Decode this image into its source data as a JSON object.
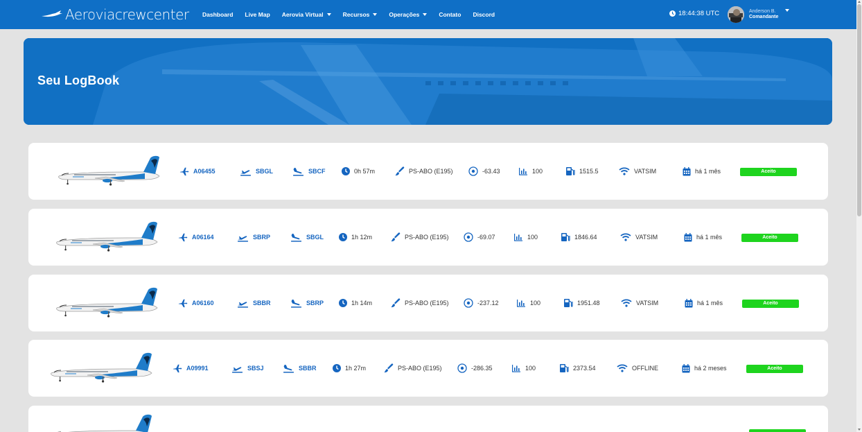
{
  "brand": {
    "name_part1": "Aerovia",
    "name_part2": "crewcenter"
  },
  "nav": {
    "items": [
      {
        "label": "Dashboard",
        "dropdown": false
      },
      {
        "label": "Live Map",
        "dropdown": false
      },
      {
        "label": "Aerovia Virtual",
        "dropdown": true
      },
      {
        "label": "Recursos",
        "dropdown": true
      },
      {
        "label": "Operações",
        "dropdown": true
      },
      {
        "label": "Contato",
        "dropdown": false
      },
      {
        "label": "Discord",
        "dropdown": false
      }
    ]
  },
  "clock": {
    "time": "18:44:38 UTC"
  },
  "user": {
    "name": "Anderson B.",
    "rank": "Comandante"
  },
  "hero": {
    "title": "Seu LogBook"
  },
  "colors": {
    "primary": "#0f6fc6",
    "accent_text": "#1565c0",
    "accepted": "#1ed41e",
    "page_bg": "#e3e3e3"
  },
  "logbook": [
    {
      "flight": "A06455",
      "departure": "SBGL",
      "arrival": "SBCF",
      "duration": "0h 57m",
      "aircraft": "PS-ABO (E195)",
      "landing_rate": "-63.43",
      "score": "100",
      "fuel": "1515.5",
      "network": "VATSIM",
      "date": "há 1 mês",
      "status": "Aceito"
    },
    {
      "flight": "A06164",
      "departure": "SBRP",
      "arrival": "SBGL",
      "duration": "1h 12m",
      "aircraft": "PS-ABO (E195)",
      "landing_rate": "-69.07",
      "score": "100",
      "fuel": "1846.64",
      "network": "VATSIM",
      "date": "há 1 mês",
      "status": "Aceito"
    },
    {
      "flight": "A06160",
      "departure": "SBBR",
      "arrival": "SBRP",
      "duration": "1h 14m",
      "aircraft": "PS-ABO (E195)",
      "landing_rate": "-237.12",
      "score": "100",
      "fuel": "1951.48",
      "network": "VATSIM",
      "date": "há 1 mês",
      "status": "Aceito"
    },
    {
      "flight": "A09991",
      "departure": "SBSJ",
      "arrival": "SBBR",
      "duration": "1h 27m",
      "aircraft": "PS-ABO (E195)",
      "landing_rate": "-286.35",
      "score": "100",
      "fuel": "2373.54",
      "network": "OFFLINE",
      "date": "há 2 meses",
      "status": "Aceito"
    }
  ]
}
